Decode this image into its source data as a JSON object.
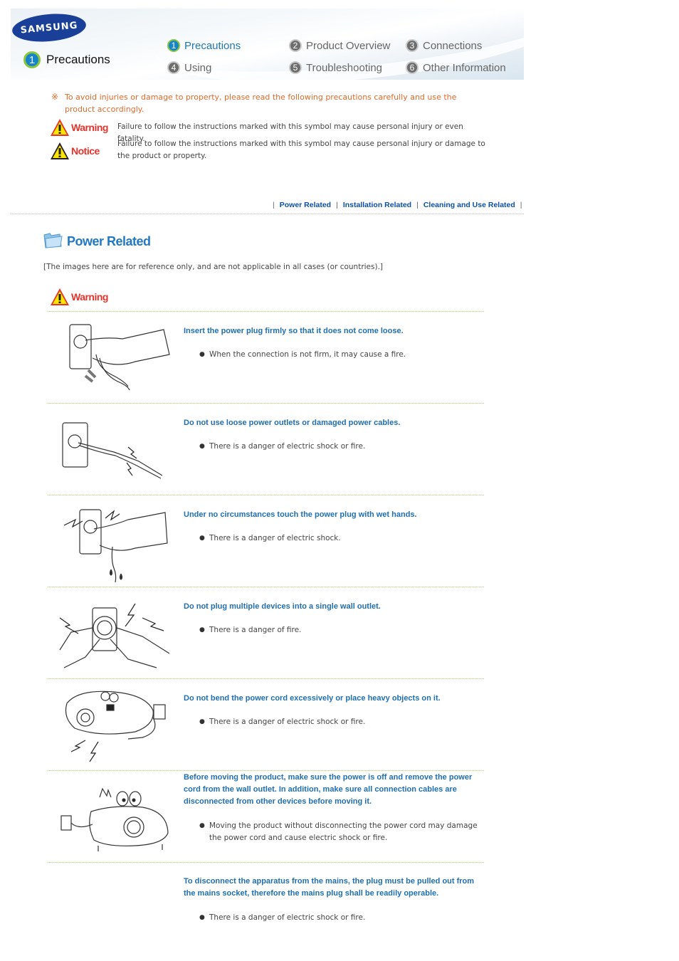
{
  "header": {
    "brand": "SAMSUNG",
    "page_title": {
      "number": "1",
      "label": "Precautions"
    },
    "nav": [
      {
        "number": "1",
        "label": "Precautions",
        "active": true
      },
      {
        "number": "2",
        "label": "Product Overview",
        "active": false
      },
      {
        "number": "3",
        "label": "Connections",
        "active": false
      },
      {
        "number": "4",
        "label": "Using",
        "active": false
      },
      {
        "number": "5",
        "label": "Troubleshooting",
        "active": false
      },
      {
        "number": "6",
        "label": "Other Information",
        "active": false
      }
    ]
  },
  "intro": {
    "mark": "※",
    "text": "To avoid injuries or damage to property, please read the following precautions carefully and use the product accordingly."
  },
  "legend": [
    {
      "word": "Warning",
      "description": "Failure to follow the instructions marked with this symbol may cause personal injury or even fatality."
    },
    {
      "word": "Notice",
      "description": "Failure to follow the instructions marked with this symbol may cause personal injury or damage to the product or property."
    }
  ],
  "sub_nav": {
    "separator": "|",
    "links": [
      "Power Related",
      "Installation Related",
      "Cleaning and Use Related"
    ]
  },
  "section": {
    "title": "Power Related",
    "note": "[The images here are for reference only, and are not applicable in all cases (or countries).]",
    "warning_label": "Warning",
    "items": [
      {
        "illustration": "hand-inserting-plug",
        "title": "Insert the power plug firmly so that it does not come loose.",
        "bullet": "When the connection is not firm, it may cause a fire."
      },
      {
        "illustration": "damaged-outlet-cable",
        "title": "Do not use loose power outlets or damaged power cables.",
        "bullet": "There is a danger of electric shock or fire."
      },
      {
        "illustration": "wet-hand-plug",
        "title": "Under no circumstances touch the power plug with wet hands.",
        "bullet": "There is a danger of electric shock."
      },
      {
        "illustration": "multiple-plugs-outlet",
        "title": "Do not plug multiple devices into a single wall outlet.",
        "bullet": "There is a danger of fire."
      },
      {
        "illustration": "bent-cord-projector",
        "title": "Do not bend the power cord excessively or place heavy objects on it.",
        "bullet": "There is a danger of electric shock or fire."
      },
      {
        "illustration": "moving-projector",
        "title": "Before moving the product, make sure the power is off and remove the power cord from the wall outlet. In addition, make sure all connection cables are disconnected from other devices before moving it.",
        "bullet": "Moving the product without disconnecting the power cord may damage the power cord and cause electric shock or fire."
      },
      {
        "illustration": "",
        "title": "To disconnect the apparatus from the mains, the plug must be pulled out from the mains socket, therefore the mains plug shall be readily operable.",
        "bullet": "There is a danger of electric shock or fire."
      }
    ]
  }
}
